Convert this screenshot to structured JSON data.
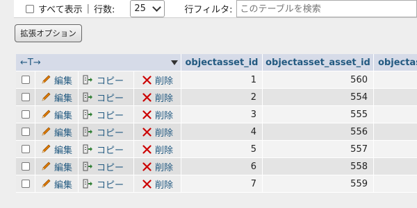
{
  "toolbar": {
    "show_all_label": "すべて表示",
    "separator": "|",
    "rows_label": "行数:",
    "rows_value": "25",
    "filter_label": "行フィルタ:",
    "filter_placeholder": "このテーブルを検索"
  },
  "extended_options_label": "拡張オプション",
  "table": {
    "arrows_label": "←T→",
    "columns": [
      "objectasset_id",
      "objectasset_asset_id",
      "objectas"
    ],
    "action_labels": {
      "edit": "編集",
      "copy": "コピー",
      "delete": "削除"
    },
    "rows": [
      {
        "id": "1",
        "asset_id": "560"
      },
      {
        "id": "2",
        "asset_id": "554"
      },
      {
        "id": "3",
        "asset_id": "555"
      },
      {
        "id": "4",
        "asset_id": "556"
      },
      {
        "id": "5",
        "asset_id": "557"
      },
      {
        "id": "6",
        "asset_id": "558"
      },
      {
        "id": "7",
        "asset_id": "559"
      }
    ]
  },
  "colors": {
    "header_bg": "#d6dbe8",
    "link": "#235a81",
    "delete_icon": "#cc0000",
    "edit_icon": "#e07b00"
  }
}
